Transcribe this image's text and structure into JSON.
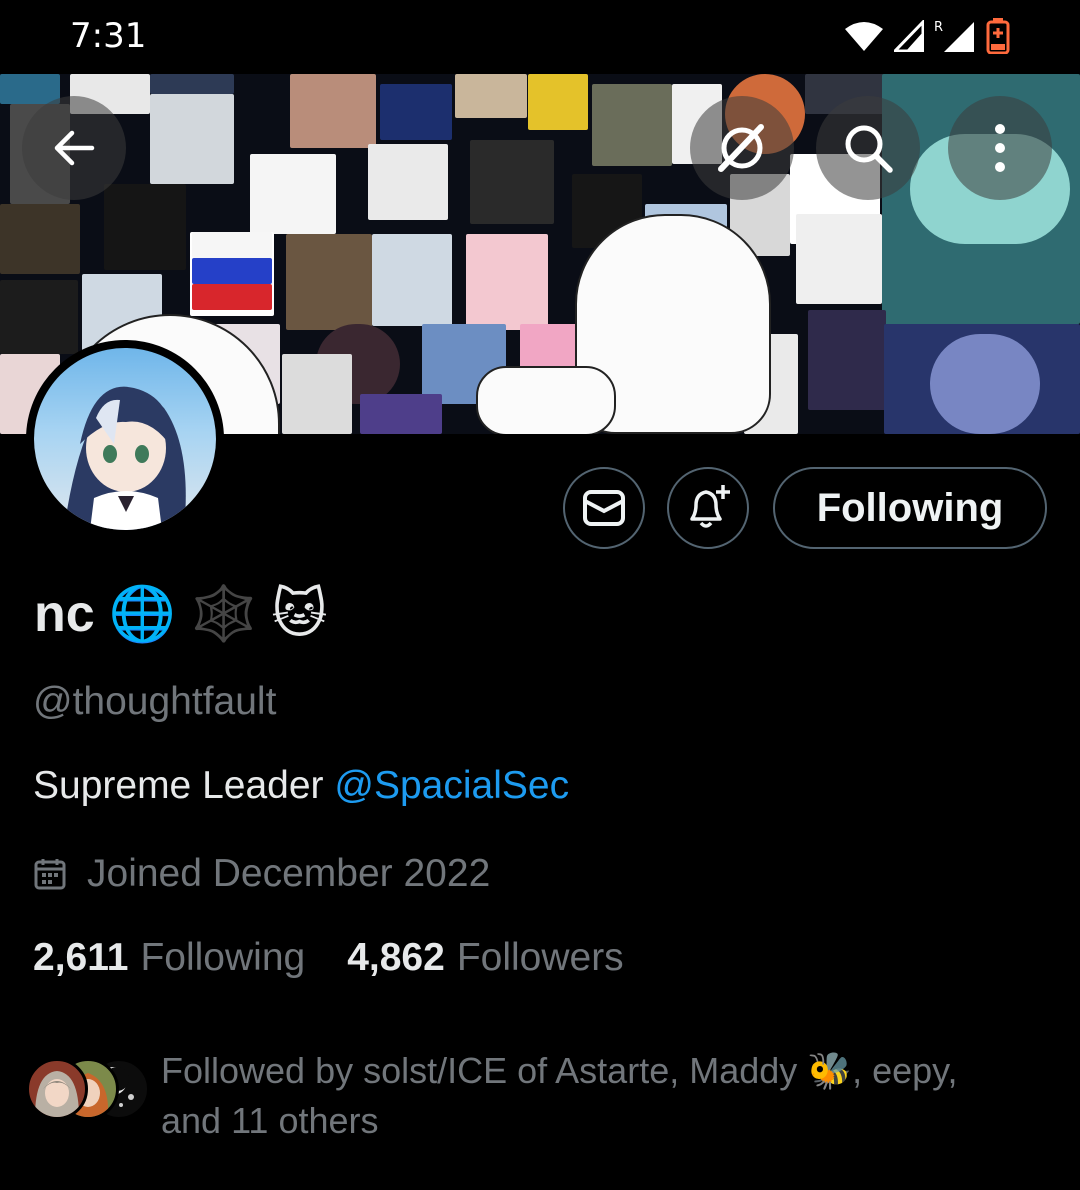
{
  "status_bar": {
    "time": "7:31",
    "roaming_indicator": "R",
    "icons": [
      "wifi-icon",
      "signal-icon",
      "signal-roaming-icon",
      "battery-low-icon"
    ]
  },
  "header": {
    "back_icon": "arrow-left-icon",
    "grok_icon": "grok-icon",
    "search_icon": "search-icon",
    "more_icon": "more-vertical-icon"
  },
  "profile": {
    "display_name": "nc",
    "name_emojis": [
      "🌐",
      "🕸️",
      "🐱"
    ],
    "handle": "@thoughtfault",
    "bio_text": "Supreme Leader ",
    "bio_mention": "@SpacialSec",
    "joined": "Joined December 2022",
    "following_count": "2,611",
    "following_label": "Following",
    "followers_count": "4,862",
    "followers_label": "Followers"
  },
  "actions": {
    "message_icon": "mail-icon",
    "notify_icon": "bell-plus-icon",
    "follow_state_label": "Following"
  },
  "followed_by": {
    "text_prefix": "Followed by solst/ICE of Astarte, Maddy ",
    "bee_emoji": "🐝",
    "text_middle": ", eepy,",
    "text_suffix": "and 11 others"
  },
  "colors": {
    "background": "#000000",
    "primary_text": "#e7e9ea",
    "secondary_text": "#71767b",
    "accent": "#1d9bf0",
    "border": "#536471"
  }
}
